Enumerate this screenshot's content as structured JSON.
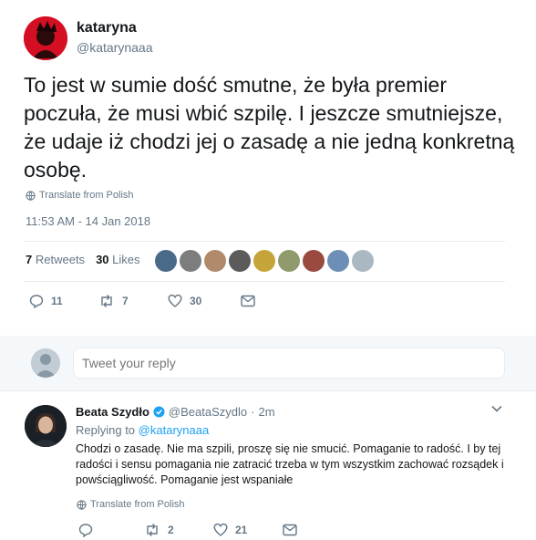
{
  "main_tweet": {
    "display_name": "kataryna",
    "handle": "@katarynaaa",
    "text": "To jest w sumie dość smutne, że była premier poczuła, że musi wbić szpilę. I jeszcze smutniejsze, że udaje iż chodzi jej o zasadę a nie jedną konkretną osobę.",
    "translate_label": "Translate from Polish",
    "timestamp": "11:53 AM - 14 Jan 2018",
    "retweets_count": "7",
    "retweets_label": "Retweets",
    "likes_count": "30",
    "likes_label": "Likes",
    "liker_colors": [
      "#4a6a8a",
      "#7d7d7d",
      "#b08a6a",
      "#5b5b5b",
      "#c5a43a",
      "#8f9a6d",
      "#9b4a3f",
      "#6d8fb5",
      "#aab8c2"
    ],
    "actions": {
      "reply_count": "11",
      "retweet_count": "7",
      "like_count": "30"
    }
  },
  "reply_box": {
    "placeholder": "Tweet your reply"
  },
  "reply_tweet": {
    "display_name": "Beata Szydło",
    "handle": "@BeataSzydlo",
    "separator": "·",
    "time": "2m",
    "replying_prefix": "Replying to",
    "replying_handle": "@katarynaaa",
    "text": "Chodzi o zasadę. Nie ma szpili, proszę się nie smucić. Pomaganie to radość. I by tej radości i sensu pomagania nie zatracić trzeba w tym wszystkim zachować rozsądek i powściągliwość. Pomaganie jest wspaniałe",
    "translate_label": "Translate from Polish",
    "actions": {
      "retweet_count": "2",
      "like_count": "21"
    }
  },
  "colors": {
    "accent": "#1da1f2",
    "muted": "#657786",
    "text": "#14171a",
    "divider": "#e6ecf0"
  }
}
